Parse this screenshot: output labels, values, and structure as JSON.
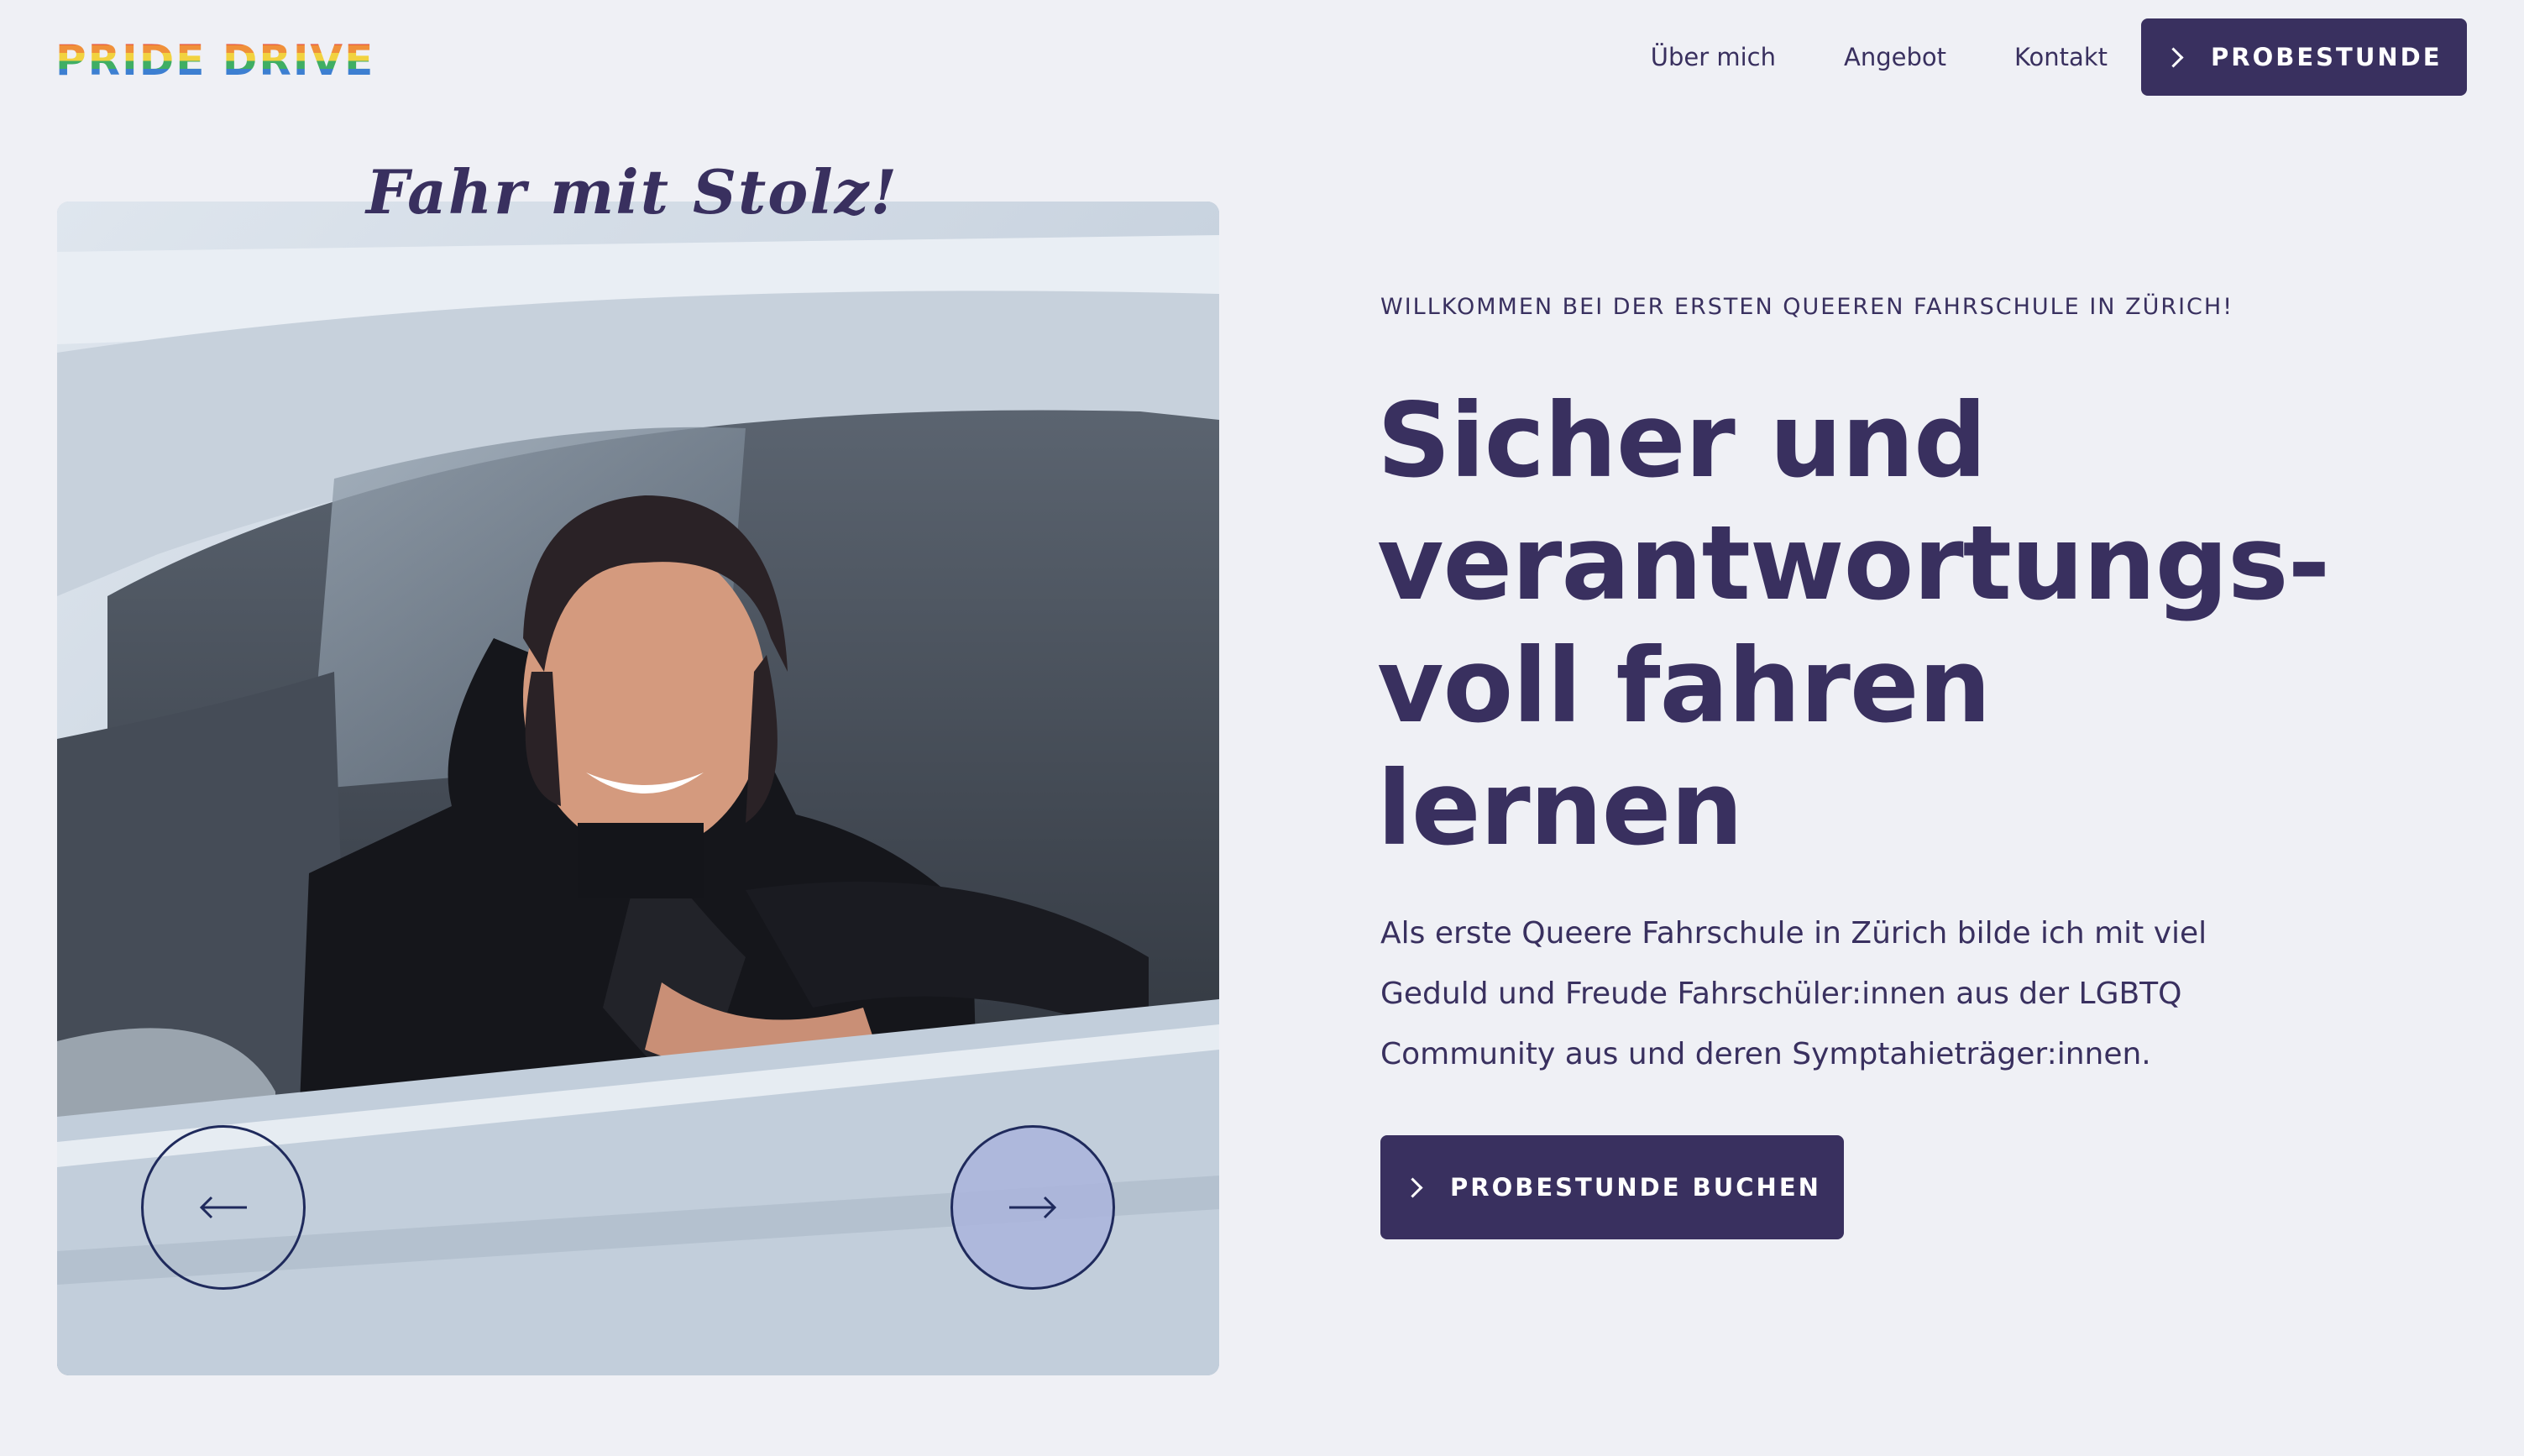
{
  "header": {
    "logo": "PRIDE DRIVE",
    "nav": [
      {
        "label": "Über mich"
      },
      {
        "label": "Angebot"
      },
      {
        "label": "Kontakt"
      }
    ],
    "cta_label": "PROBESTUNDE"
  },
  "hero": {
    "tagline": "Fahr mit Stolz!",
    "eyebrow": "WILLKOMMEN BEI DER ERSTEN QUEEREN FAHRSCHULE IN ZÜRICH!",
    "headline_lines": [
      "Sicher und",
      "verantwortungs-",
      "voll fahren",
      "lernen"
    ],
    "body": "Als erste Queere Fahrschule in Zürich bilde ich mit viel Geduld und Freude Fahrschüler:innen aus der LGBTQ Community aus und deren Symptahieträger:innen.",
    "cta_label": "PROBESTUNDE BUCHEN"
  },
  "carousel": {
    "prev_icon": "arrow-left-icon",
    "next_icon": "arrow-right-icon"
  },
  "colors": {
    "primary": "#39305f",
    "background": "#eff0f5",
    "next_button_fill": "#aab4dc"
  }
}
